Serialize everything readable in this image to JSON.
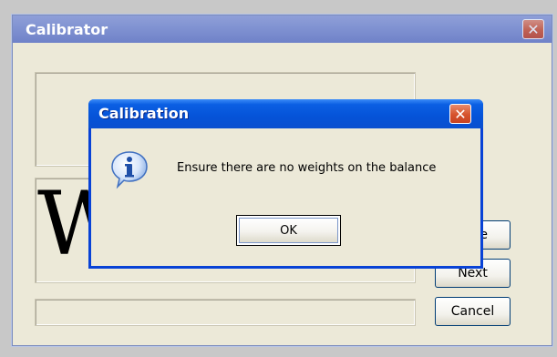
{
  "parent_window": {
    "title": "Calibrator",
    "close_label": "✕",
    "big_text": "W",
    "buttons": {
      "partial_label": "are",
      "next_label": "Next",
      "cancel_label": "Cancel"
    }
  },
  "dialog": {
    "title": "Calibration",
    "close_label": "✕",
    "icon": "info-icon",
    "message": "Ensure there are no weights on the balance",
    "ok_label": "OK"
  },
  "colors": {
    "dialog_titlebar": "#0553d8",
    "parent_titlebar": "#7d8fd0",
    "window_face": "#ece9d8",
    "close_red": "#d6532c"
  }
}
